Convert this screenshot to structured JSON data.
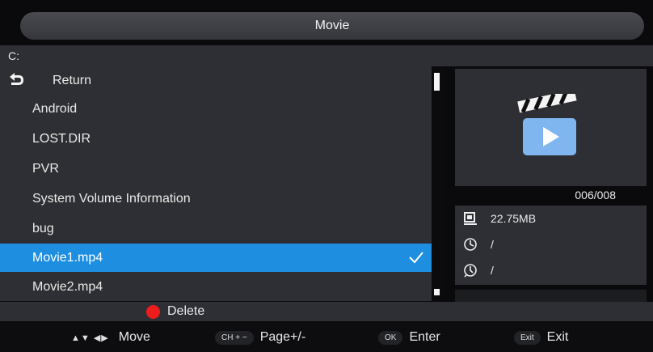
{
  "header": {
    "title": "Movie"
  },
  "path": {
    "current": "C:"
  },
  "file_list": {
    "return_label": "Return",
    "items": [
      {
        "label": "Android",
        "selected": false
      },
      {
        "label": "LOST.DIR",
        "selected": false
      },
      {
        "label": "PVR",
        "selected": false
      },
      {
        "label": "System Volume Information",
        "selected": false
      },
      {
        "label": "bug",
        "selected": false
      },
      {
        "label": "Movie1.mp4",
        "selected": true,
        "checked": true
      },
      {
        "label": "Movie2.mp4",
        "selected": false
      }
    ]
  },
  "preview": {
    "icon": "movie-clapper-icon",
    "counter": "006/008"
  },
  "info": {
    "size": "22.75MB",
    "time": "/",
    "duration": "/"
  },
  "footer": {
    "delete_label": "Delete",
    "hints": {
      "move": {
        "label": "Move"
      },
      "page": {
        "key": "CH + −",
        "label": "Page+/-"
      },
      "enter": {
        "key": "OK",
        "label": "Enter"
      },
      "exit": {
        "key": "Exit",
        "label": "Exit"
      }
    }
  },
  "colors": {
    "selection": "#1e8ee0",
    "panel": "#2e2f34",
    "delete_dot": "#ee1c1c",
    "icon_blue": "#7fb6f0"
  }
}
